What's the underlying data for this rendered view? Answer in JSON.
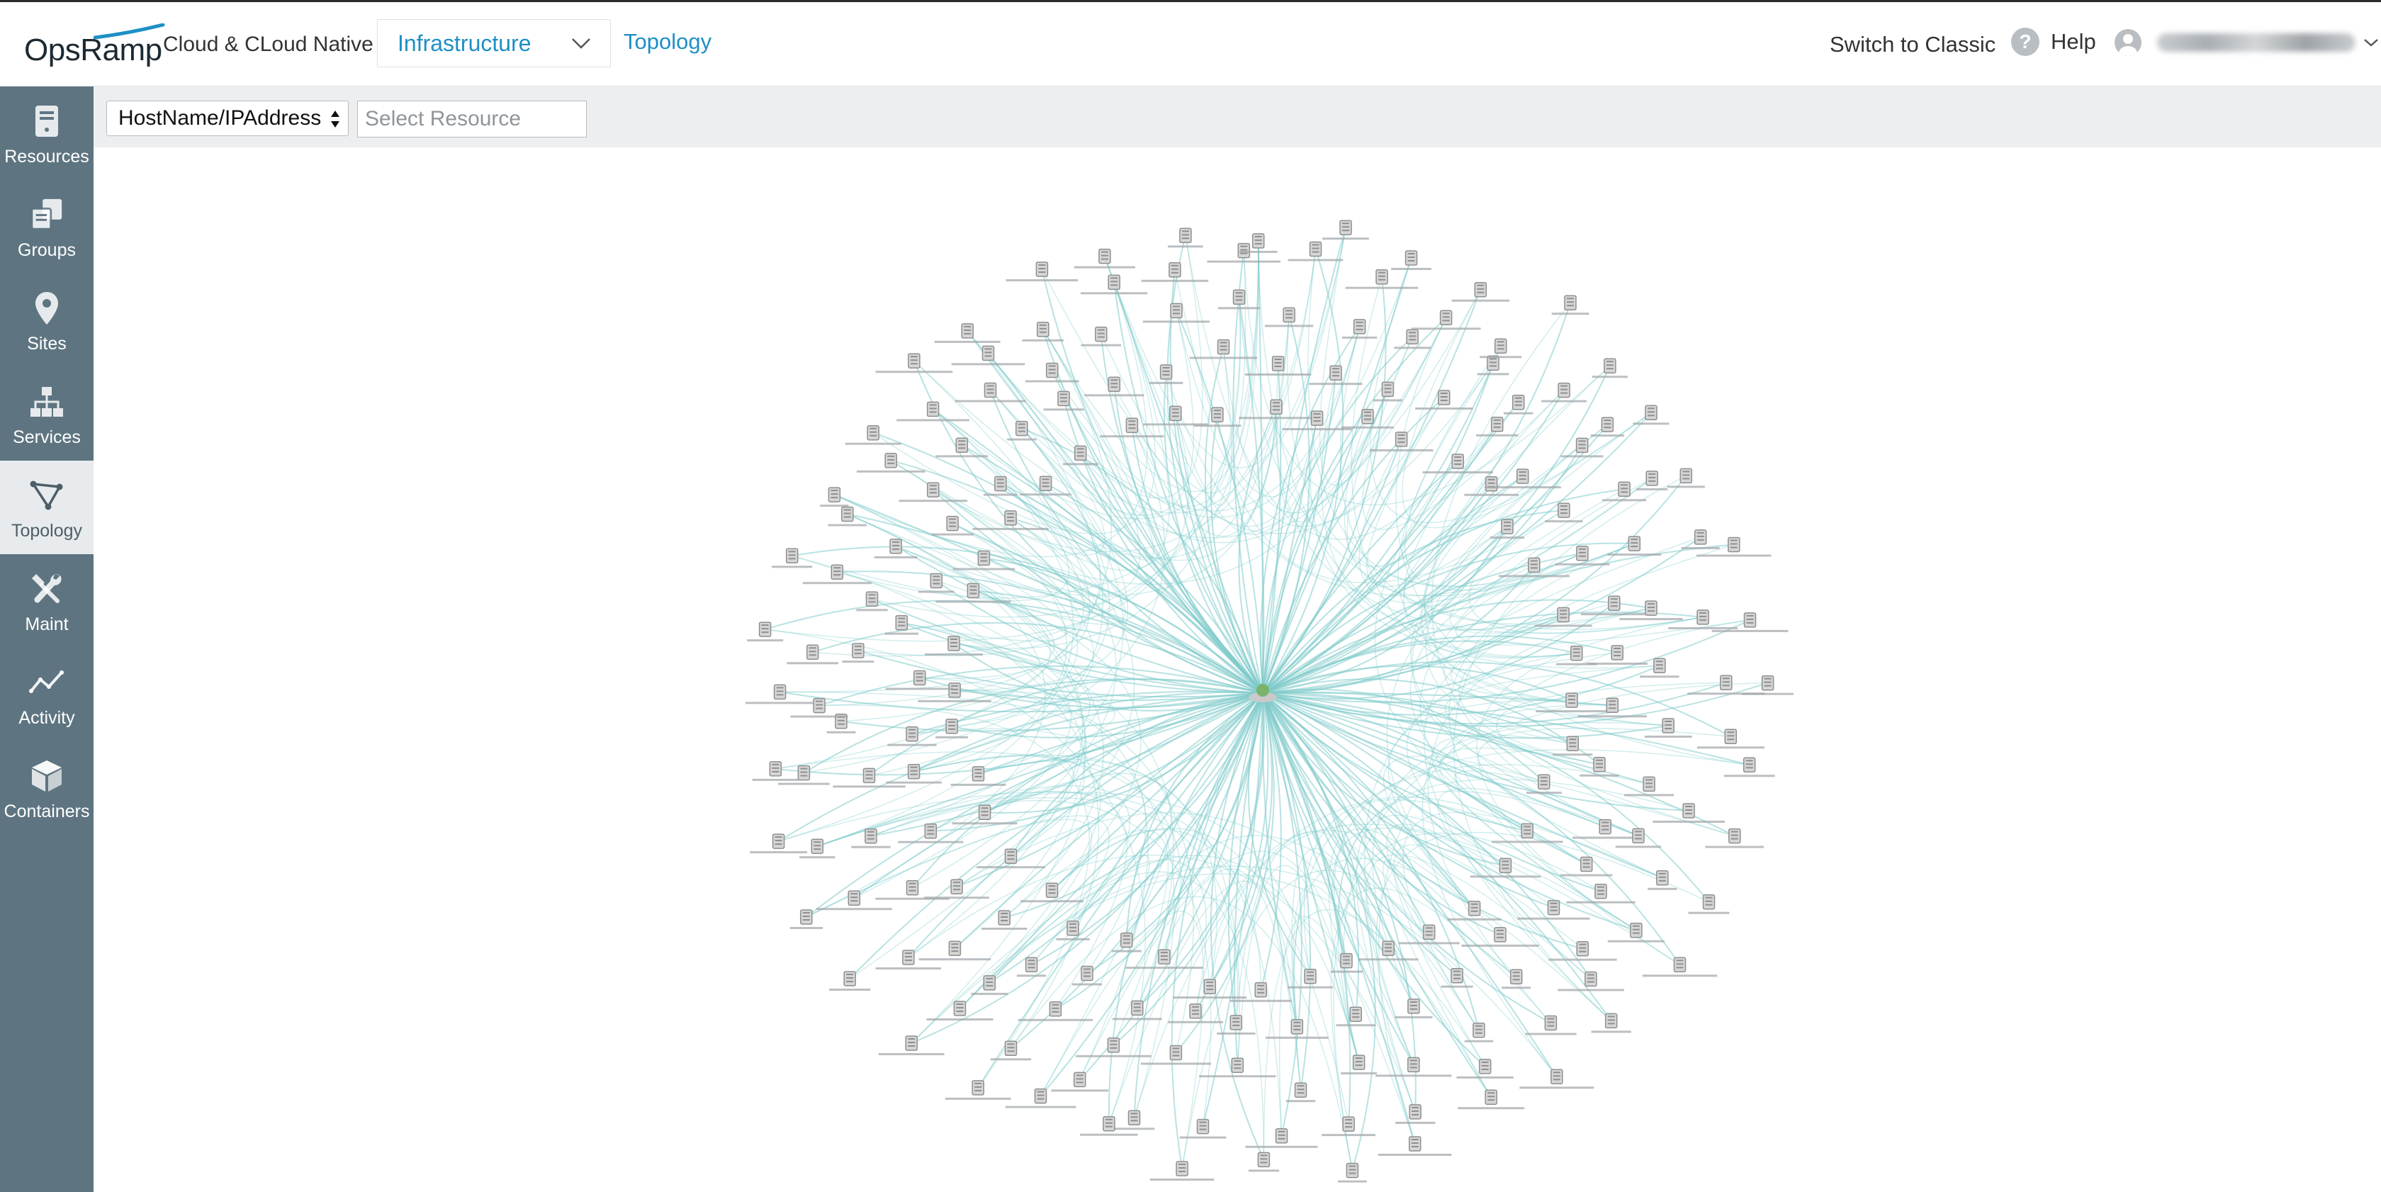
{
  "header": {
    "logo": {
      "part1": "Ops",
      "part2": "Ramp"
    },
    "org_name": "Cloud & CLoud Native",
    "nav_select": "Infrastructure",
    "nav_link": "Topology",
    "switch_classic": "Switch to Classic",
    "help_label": "Help"
  },
  "sidebar": {
    "items": [
      {
        "label": "Resources",
        "icon": "resources-icon",
        "active": false
      },
      {
        "label": "Groups",
        "icon": "groups-icon",
        "active": false
      },
      {
        "label": "Sites",
        "icon": "location-pin-icon",
        "active": false
      },
      {
        "label": "Services",
        "icon": "hierarchy-icon",
        "active": false
      },
      {
        "label": "Topology",
        "icon": "topology-icon",
        "active": true
      },
      {
        "label": "Maint",
        "icon": "wrench-icon",
        "active": false
      },
      {
        "label": "Activity",
        "icon": "activity-icon",
        "active": false
      },
      {
        "label": "Containers",
        "icon": "container-box-icon",
        "active": false
      }
    ]
  },
  "toolbar": {
    "attribute_select": "HostName/IPAddress",
    "resource_placeholder": "Select Resource"
  },
  "topology": {
    "node_count": 200,
    "link_color": "#7fcacb",
    "node_color": "#8f8f8f",
    "hub_color": "#7bb36a"
  },
  "colors": {
    "sidebar_bg": "#5e7581",
    "accent": "#1e8fc6",
    "toolbar_bg": "#eceef0"
  }
}
